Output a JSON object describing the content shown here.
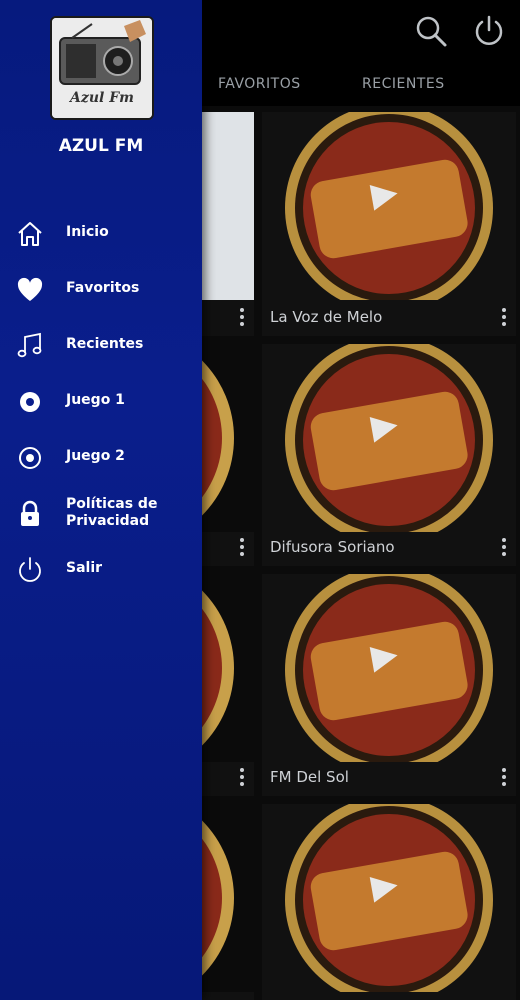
{
  "app": {
    "name": "AZUL FM",
    "logo_text": "Azul Fm"
  },
  "tabs": [
    {
      "label": "FAVORITOS"
    },
    {
      "label": "RECIENTES"
    }
  ],
  "drawer": {
    "items": [
      {
        "label": "Inicio",
        "icon": "home-icon"
      },
      {
        "label": "Favoritos",
        "icon": "heart-icon"
      },
      {
        "label": "Recientes",
        "icon": "music-note-icon"
      },
      {
        "label": "Juego 1",
        "icon": "target-icon"
      },
      {
        "label": "Juego 2",
        "icon": "target-icon"
      },
      {
        "label": "Políticas de Privacidad",
        "icon": "lock-icon"
      },
      {
        "label": "Salir",
        "icon": "power-icon"
      }
    ]
  },
  "stations": [
    {
      "title": "La Voz de Melo"
    },
    {
      "title": "Difusora Soriano"
    },
    {
      "title": "FM Del Sol"
    },
    {
      "title": ""
    }
  ],
  "colors": {
    "drawer_bg": "#0a1e8c",
    "accent_gold": "#c8a04a",
    "disc_red": "#8a2a1a"
  }
}
